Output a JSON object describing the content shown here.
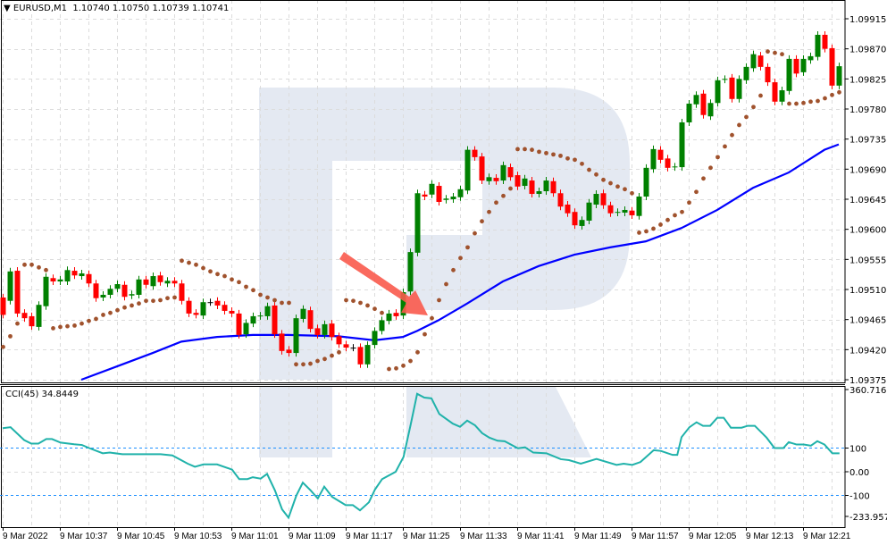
{
  "header": {
    "symbol": "EURUSD,M1",
    "ohlc": "1.10740 1.10750 1.10739 1.10741",
    "icon": "triangle-down-icon"
  },
  "colors": {
    "bull": "#008000",
    "bear": "#ff0000",
    "sar": "#a0522d",
    "ma": "#0000ff",
    "cci": "#20b2aa",
    "level": "#1e90ff",
    "watermark": "#e4e9f2",
    "arrow": "#fa5a4c"
  },
  "chart_data": [
    {
      "type": "candlestick",
      "title": "EURUSD,M1",
      "ylim": [
        1.09375,
        1.09915
      ],
      "y_ticks": [
        "1.09915",
        "1.09870",
        "1.09825",
        "1.09780",
        "1.09735",
        "1.09690",
        "1.09645",
        "1.09600",
        "1.09555",
        "1.09510",
        "1.09465",
        "1.09420",
        "1.09375"
      ],
      "x_labels": [
        "9 Mar 2022",
        "9 Mar 10:37",
        "9 Mar 10:45",
        "9 Mar 10:53",
        "9 Mar 11:01",
        "9 Mar 11:09",
        "9 Mar 11:17",
        "9 Mar 11:25",
        "9 Mar 11:33",
        "9 Mar 11:41",
        "9 Mar 11:49",
        "9 Mar 11:57",
        "9 Mar 12:05",
        "9 Mar 12:13",
        "9 Mar 12:21"
      ],
      "x_label_every_bars": 8,
      "grid": true,
      "candles_open_close": [
        [
          1.09498,
          1.09472
        ],
        [
          1.09493,
          1.09537
        ],
        [
          1.09538,
          1.09474
        ],
        [
          1.09475,
          1.09467
        ],
        [
          1.0947,
          1.09455
        ],
        [
          1.09454,
          1.09487
        ],
        [
          1.09485,
          1.09529
        ],
        [
          1.09527,
          1.09522
        ],
        [
          1.09522,
          1.09525
        ],
        [
          1.09522,
          1.09539
        ],
        [
          1.09538,
          1.09531
        ],
        [
          1.0953,
          1.09534
        ],
        [
          1.09533,
          1.09519
        ],
        [
          1.09519,
          1.09497
        ],
        [
          1.09498,
          1.09502
        ],
        [
          1.09502,
          1.09511
        ],
        [
          1.09511,
          1.09518
        ],
        [
          1.09517,
          1.09499
        ],
        [
          1.09501,
          1.09503
        ],
        [
          1.09502,
          1.09525
        ],
        [
          1.09525,
          1.09517
        ],
        [
          1.09515,
          1.0953
        ],
        [
          1.09531,
          1.09521
        ],
        [
          1.09519,
          1.09523
        ],
        [
          1.09523,
          1.09519
        ],
        [
          1.09519,
          1.09493
        ],
        [
          1.09493,
          1.09474
        ],
        [
          1.09475,
          1.09472
        ],
        [
          1.09471,
          1.09491
        ],
        [
          1.09491,
          1.09491
        ],
        [
          1.09493,
          1.09486
        ],
        [
          1.09487,
          1.09478
        ],
        [
          1.09478,
          1.09474
        ],
        [
          1.09474,
          1.09442
        ],
        [
          1.09443,
          1.0946
        ],
        [
          1.09459,
          1.0947
        ],
        [
          1.0947,
          1.09471
        ],
        [
          1.0947,
          1.09485
        ],
        [
          1.09486,
          1.09443
        ],
        [
          1.09444,
          1.09418
        ],
        [
          1.0942,
          1.09415
        ],
        [
          1.09415,
          1.09467
        ],
        [
          1.09466,
          1.09481
        ],
        [
          1.09479,
          1.09451
        ],
        [
          1.09452,
          1.09442
        ],
        [
          1.09442,
          1.09458
        ],
        [
          1.09459,
          1.09439
        ],
        [
          1.0944,
          1.09428
        ],
        [
          1.09428,
          1.09423
        ],
        [
          1.09423,
          1.09423
        ],
        [
          1.09424,
          1.09398
        ],
        [
          1.09398,
          1.09427
        ],
        [
          1.09427,
          1.09448
        ],
        [
          1.09448,
          1.09464
        ],
        [
          1.09463,
          1.09474
        ],
        [
          1.09475,
          1.0947
        ],
        [
          1.09471,
          1.09506
        ],
        [
          1.09507,
          1.09566
        ],
        [
          1.09565,
          1.09654
        ],
        [
          1.09652,
          1.09649
        ],
        [
          1.09652,
          1.09668
        ],
        [
          1.09665,
          1.09641
        ],
        [
          1.09644,
          1.09646
        ],
        [
          1.09645,
          1.09649
        ],
        [
          1.09648,
          1.0966
        ],
        [
          1.09658,
          1.09719
        ],
        [
          1.09719,
          1.09708
        ],
        [
          1.09709,
          1.09673
        ],
        [
          1.09672,
          1.09678
        ],
        [
          1.09677,
          1.09672
        ],
        [
          1.09673,
          1.09696
        ],
        [
          1.09693,
          1.09678
        ],
        [
          1.09681,
          1.09664
        ],
        [
          1.09665,
          1.09676
        ],
        [
          1.09673,
          1.09653
        ],
        [
          1.09653,
          1.09657
        ],
        [
          1.09657,
          1.09673
        ],
        [
          1.09672,
          1.09654
        ],
        [
          1.09654,
          1.09634
        ],
        [
          1.09637,
          1.09624
        ],
        [
          1.09626,
          1.09606
        ],
        [
          1.09605,
          1.09614
        ],
        [
          1.09613,
          1.0964
        ],
        [
          1.09637,
          1.09653
        ],
        [
          1.09654,
          1.09636
        ],
        [
          1.09636,
          1.09624
        ],
        [
          1.09625,
          1.09626
        ],
        [
          1.09625,
          1.09629
        ],
        [
          1.09628,
          1.09621
        ],
        [
          1.0962,
          1.09649
        ],
        [
          1.09649,
          1.09692
        ],
        [
          1.0969,
          1.0972
        ],
        [
          1.09719,
          1.09704
        ],
        [
          1.09706,
          1.09692
        ],
        [
          1.09693,
          1.09694
        ],
        [
          1.09693,
          1.0976
        ],
        [
          1.0976,
          1.09788
        ],
        [
          1.09787,
          1.09801
        ],
        [
          1.09803,
          1.09771
        ],
        [
          1.09769,
          1.09789
        ],
        [
          1.09789,
          1.09823
        ],
        [
          1.09824,
          1.09825
        ],
        [
          1.09827,
          1.09795
        ],
        [
          1.09795,
          1.09825
        ],
        [
          1.09823,
          1.09843
        ],
        [
          1.09841,
          1.09862
        ],
        [
          1.0986,
          1.09843
        ],
        [
          1.09843,
          1.0982
        ],
        [
          1.0982,
          1.09791
        ],
        [
          1.09791,
          1.09808
        ],
        [
          1.09807,
          1.09855
        ],
        [
          1.09855,
          1.09833
        ],
        [
          1.09835,
          1.09855
        ],
        [
          1.09853,
          1.09859
        ],
        [
          1.09858,
          1.09891
        ],
        [
          1.09891,
          1.0987
        ],
        [
          1.09871,
          1.09815
        ],
        [
          1.09815,
          1.09844
        ]
      ],
      "parabolic_sar": [
        1.09424,
        1.0944,
        1.09459,
        1.09547,
        1.09547,
        1.09543,
        1.09539,
        1.09452,
        1.09454,
        1.09455,
        1.09456,
        1.09459,
        1.09463,
        1.09466,
        1.09472,
        1.09475,
        1.09479,
        1.09483,
        1.09486,
        1.09489,
        1.09493,
        1.09493,
        1.09494,
        1.09497,
        1.09498,
        1.09553,
        1.0955,
        1.09547,
        1.09542,
        1.09537,
        1.09533,
        1.0953,
        1.09525,
        1.09521,
        1.09514,
        1.09509,
        1.09502,
        1.09498,
        1.09494,
        1.0949,
        1.0949,
        1.09398,
        1.09398,
        1.09399,
        1.09403,
        1.09406,
        1.09411,
        1.09416,
        1.09494,
        1.09493,
        1.0949,
        1.09486,
        1.09481,
        1.09475,
        1.09391,
        1.09392,
        1.09396,
        1.09403,
        1.09416,
        1.09443,
        1.09467,
        1.09494,
        1.09518,
        1.09539,
        1.09557,
        1.09573,
        1.09594,
        1.09612,
        1.09626,
        1.0964,
        1.0965,
        1.09661,
        1.0972,
        1.0972,
        1.09719,
        1.09716,
        1.09714,
        1.09712,
        1.0971,
        1.09706,
        1.09704,
        1.09698,
        1.09689,
        1.09682,
        1.09674,
        1.09669,
        1.09664,
        1.0966,
        1.09654,
        1.09595,
        1.09597,
        1.09601,
        1.09607,
        1.09614,
        1.09621,
        1.09626,
        1.0964,
        1.09656,
        1.09676,
        1.09692,
        1.09708,
        1.09724,
        1.09741,
        1.09756,
        1.09768,
        1.09783,
        1.098,
        1.09866,
        1.09864,
        1.09862,
        1.09788,
        1.09788,
        1.09789,
        1.09791,
        1.09792,
        1.09796,
        1.09801,
        1.09805
      ],
      "moving_average": [
        [
          11,
          1.09375
        ],
        [
          16,
          1.09395
        ],
        [
          21,
          1.09415
        ],
        [
          25,
          1.09432
        ],
        [
          30,
          1.09439
        ],
        [
          35,
          1.09442
        ],
        [
          40,
          1.09442
        ],
        [
          47,
          1.0944
        ],
        [
          52,
          1.09434
        ],
        [
          56,
          1.09439
        ],
        [
          58,
          1.09448
        ],
        [
          61,
          1.09464
        ],
        [
          65,
          1.09489
        ],
        [
          70,
          1.09522
        ],
        [
          75,
          1.09545
        ],
        [
          80,
          1.09562
        ],
        [
          85,
          1.09573
        ],
        [
          90,
          1.09582
        ],
        [
          95,
          1.09602
        ],
        [
          100,
          1.09629
        ],
        [
          105,
          1.09662
        ],
        [
          110,
          1.09685
        ],
        [
          115,
          1.09719
        ],
        [
          117,
          1.09727
        ]
      ]
    },
    {
      "type": "line",
      "title": "CCI(45) 34.8449",
      "ylim": [
        -233.9572,
        360.7166
      ],
      "y_ticks": [
        "360.7166",
        "100",
        "0.00",
        "-100",
        "-233.9572"
      ],
      "levels": [
        100,
        -100
      ],
      "series": [
        {
          "name": "CCI(45)",
          "points": [
            [
              0,
              184
            ],
            [
              1.1,
              188
            ],
            [
              3,
              134
            ],
            [
              4,
              119
            ],
            [
              5,
              119
            ],
            [
              6.1,
              138
            ],
            [
              6.9,
              138
            ],
            [
              8.1,
              123
            ],
            [
              10,
              116
            ],
            [
              11.1,
              113
            ],
            [
              12.1,
              100
            ],
            [
              14,
              78
            ],
            [
              15,
              81
            ],
            [
              16.75,
              74
            ],
            [
              22.1,
              74
            ],
            [
              23.75,
              69
            ],
            [
              25.9,
              34
            ],
            [
              26.9,
              21
            ],
            [
              28.1,
              31
            ],
            [
              30,
              31
            ],
            [
              32.1,
              9
            ],
            [
              33.1,
              -31
            ],
            [
              34.25,
              -31
            ],
            [
              35,
              -23
            ],
            [
              36.1,
              -29
            ],
            [
              37,
              -9
            ],
            [
              38.1,
              -79
            ],
            [
              39.1,
              -159
            ],
            [
              40,
              -194
            ],
            [
              41.1,
              -100
            ],
            [
              42,
              -46
            ],
            [
              43.1,
              -79
            ],
            [
              44.1,
              -113
            ],
            [
              45,
              -63
            ],
            [
              46.1,
              -106
            ],
            [
              48,
              -141
            ],
            [
              49,
              -141
            ],
            [
              50,
              -163
            ],
            [
              51.25,
              -129
            ],
            [
              52.1,
              -75
            ],
            [
              53.1,
              -31
            ],
            [
              55,
              0
            ],
            [
              56.1,
              63
            ],
            [
              57.1,
              200
            ],
            [
              58,
              329
            ],
            [
              59,
              313
            ],
            [
              60,
              310
            ],
            [
              61.1,
              244
            ],
            [
              63,
              203
            ],
            [
              64,
              190
            ],
            [
              65,
              216
            ],
            [
              66.1,
              196
            ],
            [
              67.1,
              163
            ],
            [
              68.1,
              144
            ],
            [
              69.25,
              131
            ],
            [
              70.25,
              129
            ],
            [
              72.1,
              99
            ],
            [
              73.1,
              103
            ],
            [
              74.25,
              81
            ],
            [
              76.1,
              78
            ],
            [
              78.1,
              53
            ],
            [
              79.25,
              49
            ],
            [
              80.9,
              34
            ],
            [
              83.1,
              54
            ],
            [
              85.9,
              29
            ],
            [
              86.9,
              34
            ],
            [
              88.1,
              29
            ],
            [
              89.25,
              41
            ],
            [
              91.1,
              91
            ],
            [
              92.1,
              88
            ],
            [
              93.75,
              71
            ],
            [
              94.4,
              71
            ],
            [
              95,
              146
            ],
            [
              96.1,
              188
            ],
            [
              97.1,
              209
            ],
            [
              98,
              194
            ],
            [
              99,
              194
            ],
            [
              100,
              228
            ],
            [
              100.9,
              228
            ],
            [
              101.9,
              186
            ],
            [
              103.4,
              186
            ],
            [
              104.25,
              194
            ],
            [
              105.25,
              194
            ],
            [
              106.9,
              144
            ],
            [
              108,
              100
            ],
            [
              109.25,
              100
            ],
            [
              110,
              125
            ],
            [
              111.1,
              115
            ],
            [
              112.1,
              115
            ],
            [
              113.1,
              110
            ],
            [
              114,
              129
            ],
            [
              115,
              115
            ],
            [
              116.1,
              78
            ],
            [
              117.1,
              78
            ]
          ]
        }
      ]
    }
  ]
}
